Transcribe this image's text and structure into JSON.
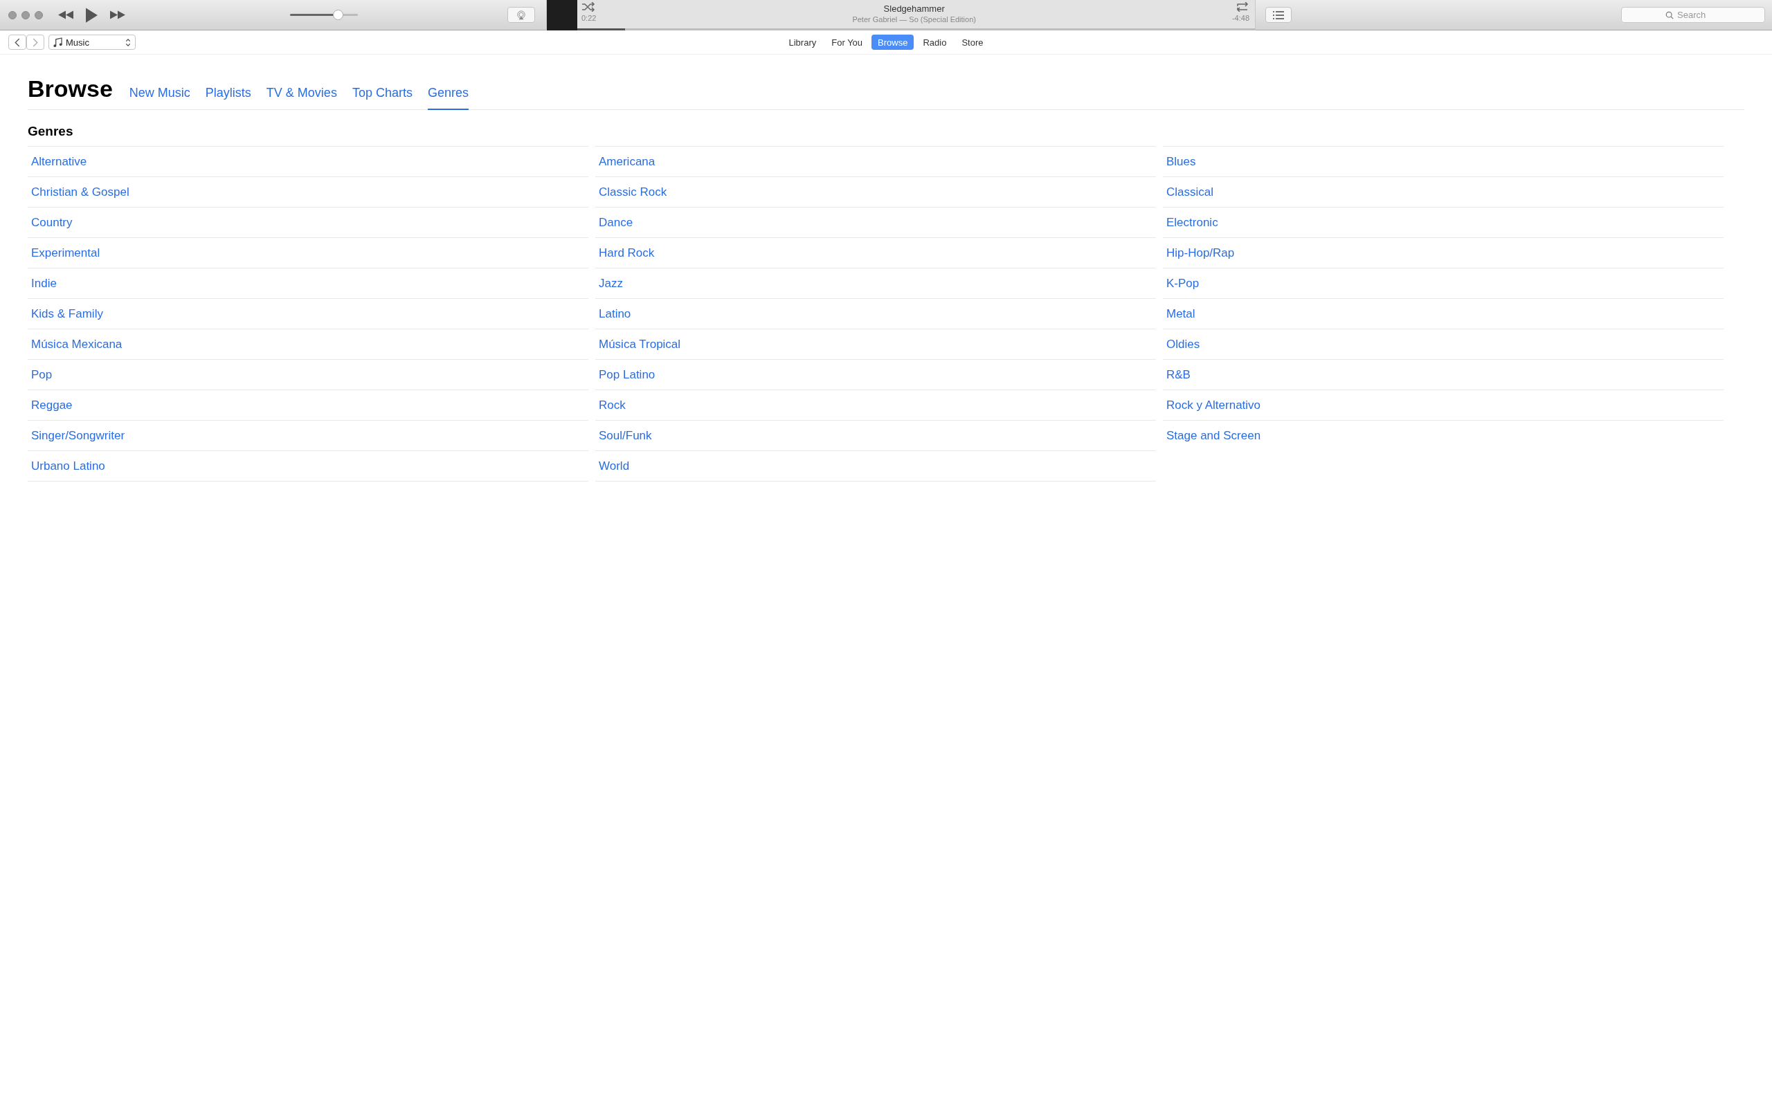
{
  "player": {
    "volume": {
      "level": 0.71
    },
    "now_playing": {
      "title": "Sledgehammer",
      "subtitle": "Peter Gabriel — So (Special Edition)",
      "elapsed": "0:22",
      "remaining": "-4:48",
      "progress": {
        "level": 0.07
      }
    },
    "search": {
      "placeholder": "Search"
    }
  },
  "nav": {
    "source": "Music",
    "tabs": [
      {
        "label": "Library",
        "selected": false
      },
      {
        "label": "For You",
        "selected": false
      },
      {
        "label": "Browse",
        "selected": true
      },
      {
        "label": "Radio",
        "selected": false
      },
      {
        "label": "Store",
        "selected": false
      }
    ]
  },
  "browse": {
    "title": "Browse",
    "tabs": [
      {
        "label": "New Music",
        "selected": false
      },
      {
        "label": "Playlists",
        "selected": false
      },
      {
        "label": "TV & Movies",
        "selected": false
      },
      {
        "label": "Top Charts",
        "selected": false
      },
      {
        "label": "Genres",
        "selected": true
      }
    ],
    "section_title": "Genres",
    "genres": [
      "Alternative",
      "Americana",
      "Blues",
      "Christian & Gospel",
      "Classic Rock",
      "Classical",
      "Country",
      "Dance",
      "Electronic",
      "Experimental",
      "Hard Rock",
      "Hip-Hop/Rap",
      "Indie",
      "Jazz",
      "K-Pop",
      "Kids & Family",
      "Latino",
      "Metal",
      "Música Mexicana",
      "Música Tropical",
      "Oldies",
      "Pop",
      "Pop Latino",
      "R&B",
      "Reggae",
      "Rock",
      "Rock y Alternativo",
      "Singer/Songwriter",
      "Soul/Funk",
      "Stage and Screen",
      "Urbano Latino",
      "World"
    ]
  }
}
